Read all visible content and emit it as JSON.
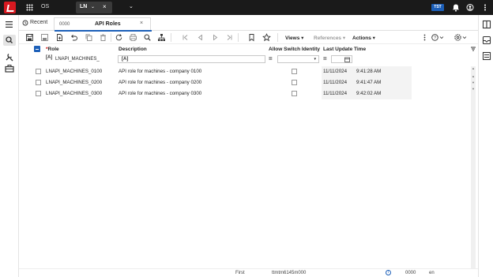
{
  "topbar": {
    "os_label": "OS",
    "app_tab_label": "LN",
    "env_badge": "TST",
    "colors": {
      "bar": "#1a1a1a",
      "logo": "#d71920",
      "accent": "#1c5fb8"
    }
  },
  "tabs": {
    "recent_label": "Recent",
    "active_tab_number": "0000",
    "active_tab_title": "API Roles"
  },
  "toolbar": {
    "views_label": "Views",
    "references_label": "References",
    "actions_label": "Actions"
  },
  "grid": {
    "columns": {
      "role": "Role",
      "description": "Description",
      "allow_switch_identity": "Allow Switch Identity",
      "last_update_time": "Last Update Time"
    },
    "filters": {
      "role_value": "LNAPI_MACHINES_",
      "description_value": ""
    },
    "rows": [
      {
        "role": "LNAPI_MACHINES_0100",
        "description": "API role for machines - company 0100",
        "allow_switch_identity": false,
        "date": "11/11/2024",
        "time": "9:41:28 AM"
      },
      {
        "role": "LNAPI_MACHINES_0200",
        "description": "API role for machines - company 0200",
        "allow_switch_identity": false,
        "date": "11/11/2024",
        "time": "9:41:47 AM"
      },
      {
        "role": "LNAPI_MACHINES_0300",
        "description": "API role for machines - company 0300",
        "allow_switch_identity": false,
        "date": "11/11/2024",
        "time": "9:42:02 AM"
      }
    ]
  },
  "footer": {
    "position": "First",
    "session_code": "ttmtm6145m000",
    "company": "0000",
    "language": "en"
  }
}
